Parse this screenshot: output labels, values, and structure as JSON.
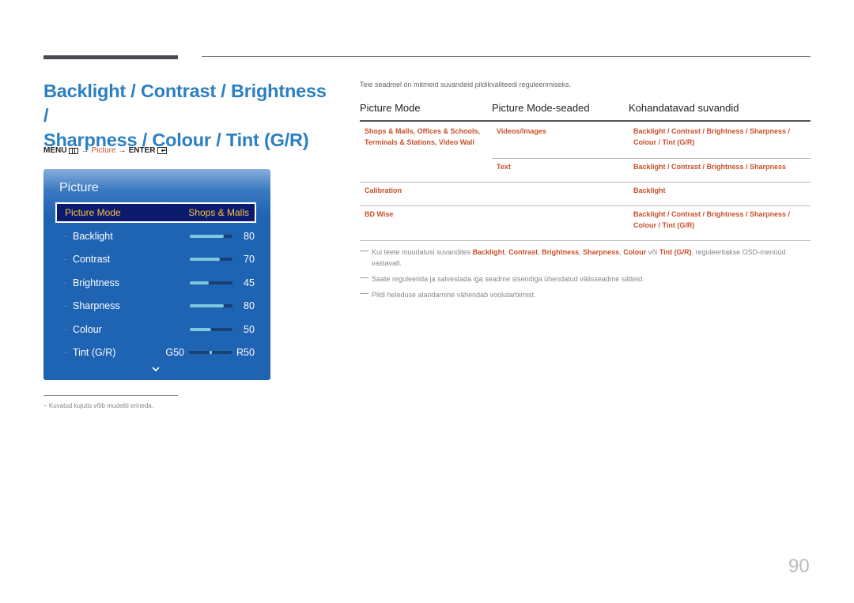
{
  "title": {
    "line1": "Backlight / Contrast / Brightness /",
    "line2": "Sharpness / Colour / Tint (G/R)"
  },
  "menu_path": {
    "menu": "MENU",
    "arrow1": "→",
    "picture": "Picture",
    "arrow2": "→",
    "enter": "ENTER",
    "enter_glyph": "↵"
  },
  "osd": {
    "title": "Picture",
    "selected": {
      "label": "Picture Mode",
      "value": "Shops & Malls"
    },
    "rows": [
      {
        "label": "Backlight",
        "value": "80",
        "level": 80
      },
      {
        "label": "Contrast",
        "value": "70",
        "level": 70
      },
      {
        "label": "Brightness",
        "value": "45",
        "level": 45
      },
      {
        "label": "Sharpness",
        "value": "80",
        "level": 80
      },
      {
        "label": "Colour",
        "value": "50",
        "level": 50
      }
    ],
    "tint": {
      "label": "Tint (G/R)",
      "g": "G50",
      "r": "R50",
      "position": 50
    },
    "bullet": "·"
  },
  "footnote": "−  Kuvatud kujutis võib mudeliti erineda.",
  "intro": "Teie seadmel on mitmeid suvandeid pildikvaliteedi reguleerimiseks.",
  "table": {
    "headers": [
      "Picture Mode",
      "Picture Mode-seaded",
      "Kohandatavad suvandid"
    ],
    "rows": [
      {
        "mode_line1": "Shops & Malls, Offices & Schools,",
        "mode_line2": "Terminals & Stations, Video Wall",
        "setting": "Videos/Images",
        "options_line1": "Backlight / Contrast / Brightness / Sharpness /",
        "options_line2": "Colour / Tint (G/R)"
      },
      {
        "mode_line1": "",
        "mode_line2": "",
        "setting": "Text",
        "options_line1": "Backlight / Contrast / Brightness / Sharpness",
        "options_line2": ""
      },
      {
        "mode_line1": "Calibration",
        "mode_line2": "",
        "setting": "",
        "options_line1": "Backlight",
        "options_line2": ""
      },
      {
        "mode_line1": "BD Wise",
        "mode_line2": "",
        "setting": "",
        "options_line1": "Backlight / Contrast / Brightness / Sharpness /",
        "options_line2": "Colour / Tint (G/R)"
      }
    ]
  },
  "notes": {
    "n1_pre": "Kui teete muudatusi suvandites ",
    "n1_b1": "Backlight",
    "n1_s1": ", ",
    "n1_b2": "Contrast",
    "n1_s2": ", ",
    "n1_b3": "Brightness",
    "n1_s3": ", ",
    "n1_b4": "Sharpness",
    "n1_s4": ", ",
    "n1_b5": "Colour",
    "n1_s5": " või ",
    "n1_b6": "Tint (G/R)",
    "n1_post": ", reguleeritakse OSD-menüüd vastavalt.",
    "n2": "Saate reguleerida ja salvestada iga seadme sisendiga ühendatud välisseadme sätteid.",
    "n3": "Pildi heleduse alandamine vähendab voolutarbimist."
  },
  "page_number": "90",
  "colors": {
    "accent_blue": "#2a80c2",
    "accent_orange": "#c8502a",
    "osd_blue": "#1f63b3",
    "osd_selected": "#0c1a6e",
    "osd_highlight": "#f5c542"
  }
}
